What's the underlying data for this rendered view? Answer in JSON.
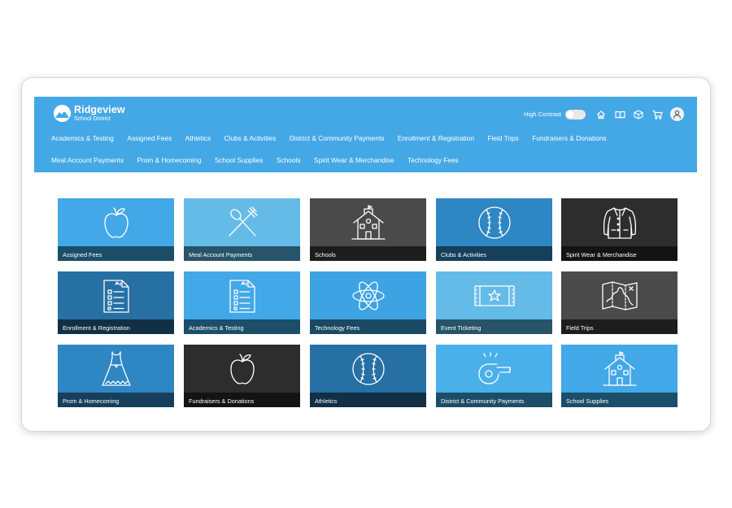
{
  "brand": {
    "name": "Ridgeview",
    "subtitle": "School District"
  },
  "header": {
    "high_contrast_label": "High Contrast",
    "high_contrast_on": false,
    "icons": [
      "home-icon",
      "book-icon",
      "box-icon",
      "cart-icon",
      "user-icon"
    ]
  },
  "nav": {
    "row1": [
      "Academics & Testing",
      "Assigned Fees",
      "Athletics",
      "Clubs & Activities",
      "District & Community Payments",
      "Enrollment & Registration",
      "Field Trips",
      "Fundraisers & Donations"
    ],
    "row2": [
      "Meal Account Payments",
      "Prom & Homecoming",
      "School Supplies",
      "Schools",
      "Spirit Wear & Merchandise",
      "Technology Fees"
    ]
  },
  "colors": {
    "header": "#45a8e6",
    "white": "#ffffff"
  },
  "tiles": [
    {
      "label": "Assigned Fees",
      "icon": "apple-icon",
      "bg": "#42a8e7",
      "cap": "#1b4e69"
    },
    {
      "label": "Meal Account Payments",
      "icon": "utensils-icon",
      "bg": "#64bbe8",
      "cap": "#275468"
    },
    {
      "label": "Schools",
      "icon": "schoolhouse-icon",
      "bg": "#4a4a4a",
      "cap": "#1d1d1d"
    },
    {
      "label": "Clubs & Activities",
      "icon": "baseball-icon",
      "bg": "#2e86c3",
      "cap": "#163f5b"
    },
    {
      "label": "Spirit Wear & Merchandise",
      "icon": "jacket-icon",
      "bg": "#2d2d2d",
      "cap": "#131313"
    },
    {
      "label": "Enrollment & Registration",
      "icon": "checklist-icon",
      "bg": "#2670a4",
      "cap": "#112f45"
    },
    {
      "label": "Academics & Testing",
      "icon": "checklist-icon",
      "bg": "#42a8e7",
      "cap": "#1b4e69"
    },
    {
      "label": "Technology Fees",
      "icon": "atom-icon",
      "bg": "#3ea3e2",
      "cap": "#1a4a63"
    },
    {
      "label": "Event Ticketing",
      "icon": "ticket-icon",
      "bg": "#64bbe8",
      "cap": "#275468"
    },
    {
      "label": "Field Trips",
      "icon": "map-icon",
      "bg": "#4a4a4a",
      "cap": "#1d1d1d"
    },
    {
      "label": "Prom & Homecoming",
      "icon": "dress-icon",
      "bg": "#2e86c3",
      "cap": "#163f5b"
    },
    {
      "label": "Fundraisers & Donations",
      "icon": "apple-icon",
      "bg": "#2d2d2d",
      "cap": "#131313"
    },
    {
      "label": "Athletics",
      "icon": "baseball-icon",
      "bg": "#2670a4",
      "cap": "#112f45"
    },
    {
      "label": "District & Community Payments",
      "icon": "whistle-icon",
      "bg": "#4ab0ea",
      "cap": "#1d4d66"
    },
    {
      "label": "School Supplies",
      "icon": "schoolhouse-icon",
      "bg": "#42a8e7",
      "cap": "#1b4e69"
    }
  ]
}
